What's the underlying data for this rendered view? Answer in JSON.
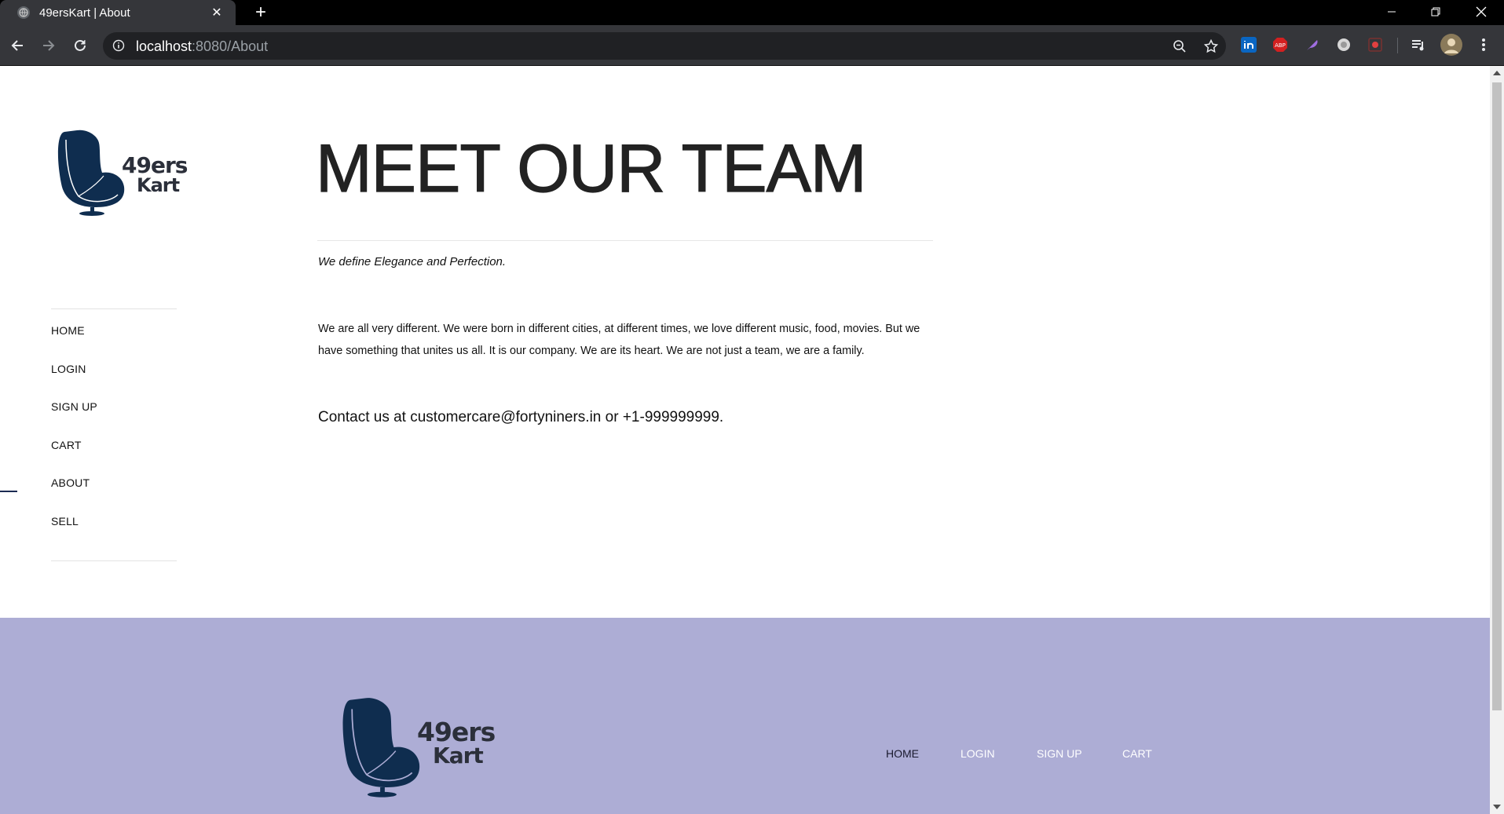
{
  "browser": {
    "tab_title": "49ersKart | About",
    "new_tab_symbol": "+",
    "close_tab_symbol": "✕",
    "url_host": "localhost",
    "url_rest": ":8080/About",
    "icons": [
      "back-arrow-icon",
      "forward-arrow-icon",
      "reload-icon",
      "info-icon",
      "zoom-icon",
      "bookmark-star-icon",
      "linkedin-icon",
      "adblock-icon",
      "feather-icon",
      "circle-icon",
      "record-icon",
      "media-queue-icon",
      "profile-avatar",
      "more-vert-icon"
    ]
  },
  "brand": {
    "line1": "49ers",
    "line2": "Kart",
    "chair_color": "#0f2d4f"
  },
  "sidebar": {
    "items": [
      {
        "label": "HOME"
      },
      {
        "label": "LOGIN"
      },
      {
        "label": "SIGN UP"
      },
      {
        "label": "CART"
      },
      {
        "label": "ABOUT"
      },
      {
        "label": "SELL"
      }
    ],
    "active": "ABOUT"
  },
  "main": {
    "heading": "MEET OUR TEAM",
    "tagline": "We define Elegance and Perfection.",
    "paragraph": "We are all very different. We were born in different cities, at different times, we love different music, food, movies. But we have something that unites us all. It is our company. We are its heart. We are not just a team, we are a family.",
    "contact": "Contact us at customercare@fortyniners.in or +1-999999999."
  },
  "footer": {
    "background": "#adadd5",
    "links": [
      {
        "label": "HOME",
        "color": "#1a1a2e"
      },
      {
        "label": "LOGIN",
        "color": "#ffffff"
      },
      {
        "label": "SIGN UP",
        "color": "#ffffff"
      },
      {
        "label": "CART",
        "color": "#ffffff"
      }
    ]
  }
}
